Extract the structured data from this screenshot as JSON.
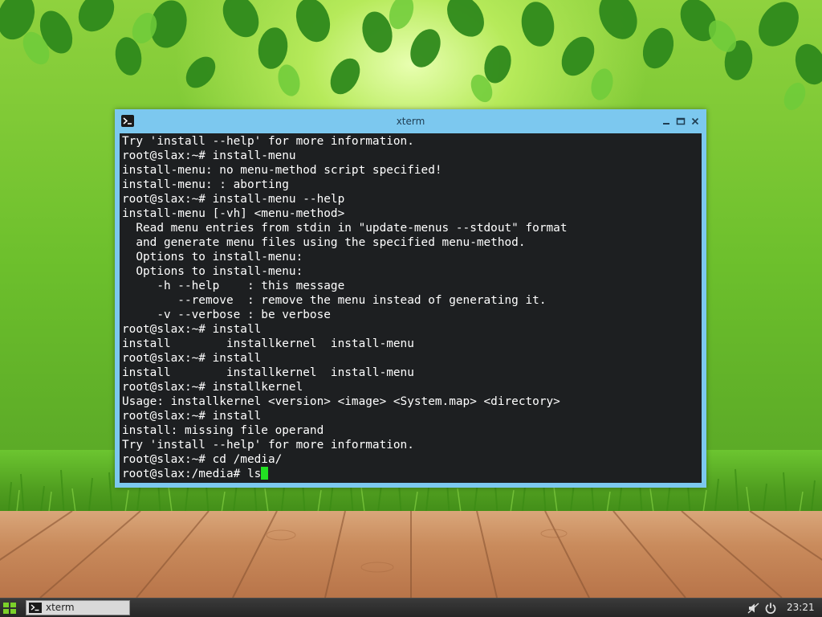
{
  "window": {
    "title": "xterm",
    "icon": "terminal-icon",
    "controls": [
      "minimize-icon",
      "maximize-icon",
      "close-icon"
    ],
    "frame_color": "#7cc8ef"
  },
  "terminal": {
    "background": "#1d1f21",
    "foreground": "#ffffff",
    "cursor_color": "#22e022",
    "lines": [
      "Try 'install --help' for more information.",
      "root@slax:~# install-menu",
      "install-menu: no menu-method script specified!",
      "install-menu: : aborting",
      "root@slax:~# install-menu --help",
      "install-menu [-vh] <menu-method>",
      "  Read menu entries from stdin in \"update-menus --stdout\" format",
      "  and generate menu files using the specified menu-method.",
      "  Options to install-menu:",
      "  Options to install-menu:",
      "     -h --help    : this message",
      "        --remove  : remove the menu instead of generating it.",
      "     -v --verbose : be verbose",
      "root@slax:~# install",
      "install        installkernel  install-menu",
      "root@slax:~# install",
      "install        installkernel  install-menu",
      "root@slax:~# installkernel",
      "Usage: installkernel <version> <image> <System.map> <directory>",
      "root@slax:~# install",
      "install: missing file operand",
      "Try 'install --help' for more information.",
      "root@slax:~# cd /media/"
    ],
    "prompt": "root@slax:/media# ",
    "current_input": "ls"
  },
  "taskbar": {
    "start_icon": "app-grid-icon",
    "tasks": [
      {
        "label": "xterm",
        "icon": "terminal-icon"
      }
    ],
    "tray": [
      "volume-muted-icon",
      "power-icon"
    ],
    "clock": "23:21"
  }
}
